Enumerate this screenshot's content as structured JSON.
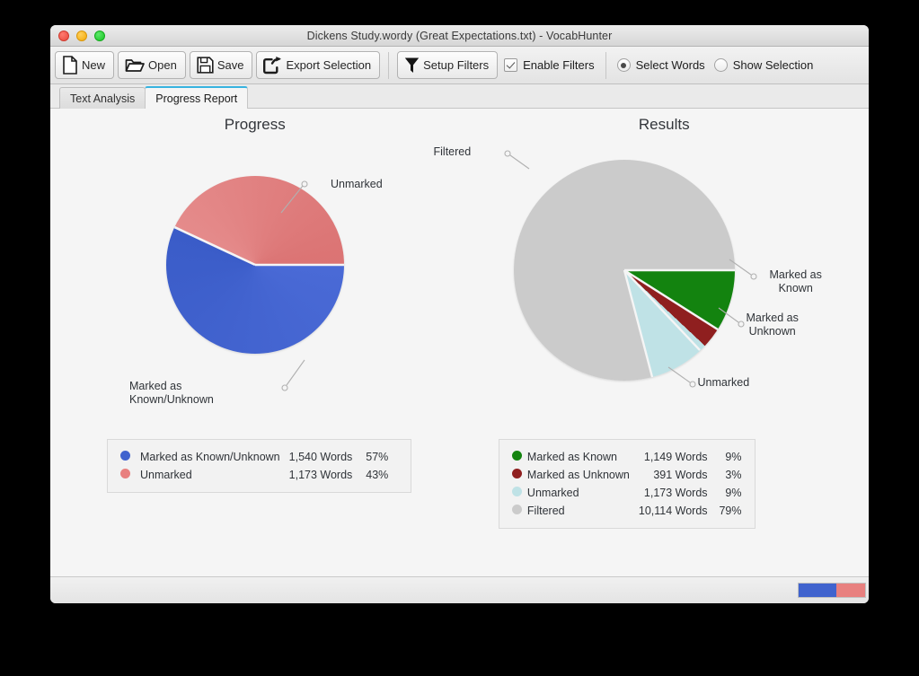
{
  "window": {
    "title": "Dickens Study.wordy (Great Expectations.txt) - VocabHunter",
    "traffic_lights": [
      "close",
      "minimize",
      "zoom"
    ]
  },
  "toolbar": {
    "new_label": "New",
    "open_label": "Open",
    "save_label": "Save",
    "export_label": "Export Selection",
    "setup_filters_label": "Setup Filters",
    "enable_filters_label": "Enable Filters",
    "enable_filters_checked": true,
    "select_words_label": "Select Words",
    "show_selection_label": "Show Selection",
    "radio_selected": "Select Words"
  },
  "tabs": [
    {
      "label": "Text Analysis",
      "active": false
    },
    {
      "label": "Progress Report",
      "active": true
    }
  ],
  "colors": {
    "marked_known_unknown": "#4063ce",
    "unmarked_progress": "#e07d7d",
    "marked_known": "#13830f",
    "marked_unknown": "#8f1f1f",
    "unmarked_results": "#bfe2e6",
    "filtered": "#cbcbcb",
    "tab_accent": "#37b3e0"
  },
  "progress_panel": {
    "title": "Progress",
    "labels": [
      {
        "text": "Unmarked"
      },
      {
        "text_line1": "Marked as",
        "text_line2": "Known/Unknown"
      }
    ],
    "legend": {
      "headers_hidden": true,
      "rows": [
        {
          "name": "Marked as Known/Unknown",
          "words": "1,540 Words",
          "percent": "57%",
          "color": "#4063ce"
        },
        {
          "name": "Unmarked",
          "words": "1,173 Words",
          "percent": "43%",
          "color": "#e07d7d"
        }
      ]
    }
  },
  "results_panel": {
    "title": "Results",
    "labels": [
      {
        "text": "Filtered"
      },
      {
        "text_line1": "Marked as",
        "text_line2": "Known"
      },
      {
        "text_line1": "Marked as",
        "text_line2": "Unknown"
      },
      {
        "text": "Unmarked"
      }
    ],
    "legend": {
      "rows": [
        {
          "name": "Marked as Known",
          "words": "1,149 Words",
          "percent": "9%",
          "color": "#13830f"
        },
        {
          "name": "Marked as Unknown",
          "words": "391 Words",
          "percent": "3%",
          "color": "#8f1f1f"
        },
        {
          "name": "Unmarked",
          "words": "1,173 Words",
          "percent": "9%",
          "color": "#bfe2e6"
        },
        {
          "name": "Filtered",
          "words": "10,114 Words",
          "percent": "79%",
          "color": "#cbcbcb"
        }
      ]
    }
  },
  "statusbar": {
    "progress_segments": [
      {
        "name": "marked",
        "percent": 57,
        "color": "#4063ce"
      },
      {
        "name": "unmarked",
        "percent": 43,
        "color": "#e8807f"
      }
    ]
  },
  "chart_data": [
    {
      "type": "pie",
      "title": "Progress",
      "categories": [
        "Marked as Known/Unknown",
        "Unmarked"
      ],
      "values": [
        1540,
        1173
      ],
      "percents": [
        57,
        43
      ],
      "value_labels": [
        "1,540 Words",
        "1,173 Words"
      ],
      "colors": [
        "#4063ce",
        "#e07d7d"
      ],
      "legend_position": "bottom",
      "start_angle_deg": 0,
      "direction": "clockwise",
      "grid": false
    },
    {
      "type": "pie",
      "title": "Results",
      "categories": [
        "Marked as Known",
        "Marked as Unknown",
        "Unmarked",
        "Filtered"
      ],
      "values": [
        1149,
        391,
        1173,
        10114
      ],
      "percents": [
        9,
        3,
        9,
        79
      ],
      "value_labels": [
        "1,149 Words",
        "391 Words",
        "1,173 Words",
        "10,114 Words"
      ],
      "colors": [
        "#13830f",
        "#8f1f1f",
        "#bfe2e6",
        "#cbcbcb"
      ],
      "legend_position": "bottom",
      "start_angle_deg": 0,
      "direction": "clockwise",
      "grid": false
    }
  ]
}
